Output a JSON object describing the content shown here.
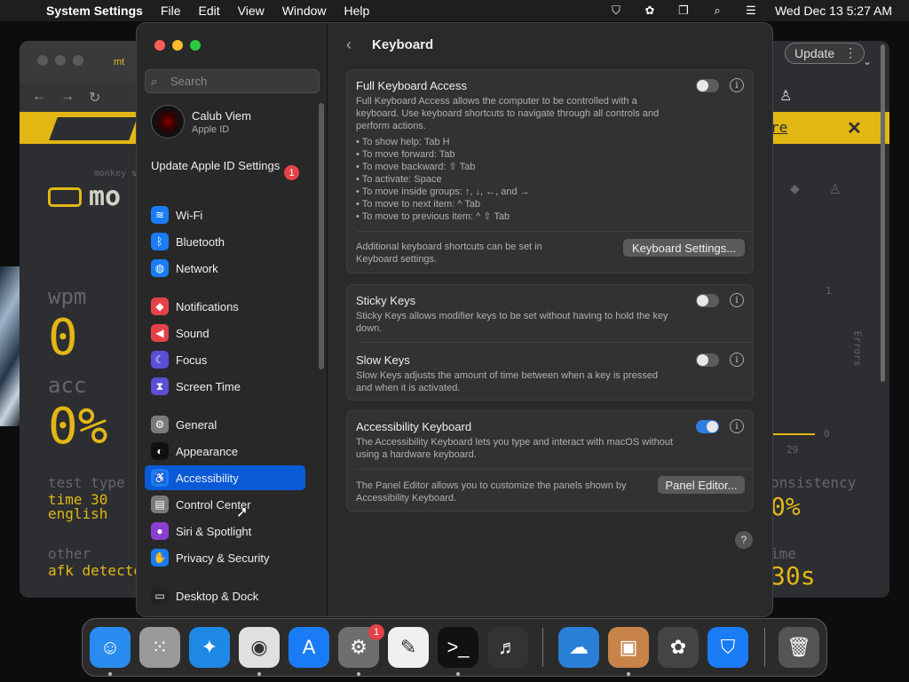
{
  "menubar": {
    "app": "System Settings",
    "items": [
      "File",
      "Edit",
      "View",
      "Window",
      "Help"
    ],
    "clock": "Wed Dec 13  5:27 AM"
  },
  "browser": {
    "tab_title": "mt",
    "update_label": "Update",
    "logo_text": "mo",
    "logo_sub": "monkey s",
    "stats": {
      "wpm_label": "wpm",
      "wpm_value": "0",
      "acc_label": "acc",
      "acc_value": "0%",
      "test_type_label": "test type",
      "test_type_value1": "time 30",
      "test_type_value2": "english",
      "other_label": "other",
      "other_value": "afk detecte",
      "consistency_label": "onsistency",
      "consistency_value": "0%",
      "time_label": "ime",
      "time_value": "30s",
      "errors_label": "Errors",
      "axis_one": "1",
      "axis_zero": "0",
      "axis_29": "29",
      "banner_text": "re"
    }
  },
  "settings": {
    "search_placeholder": "Search",
    "profile": {
      "name": "Calub Viem",
      "sub": "Apple ID"
    },
    "update_id": "Update Apple ID Settings",
    "update_badge": "1",
    "sidebar": [
      {
        "label": "Wi-Fi",
        "icon": "wifi-icon",
        "color": "#1a7cf5",
        "glyph": "≋"
      },
      {
        "label": "Bluetooth",
        "icon": "bluetooth-icon",
        "color": "#1a7cf5",
        "glyph": "ᛒ"
      },
      {
        "label": "Network",
        "icon": "globe-icon",
        "color": "#1a7cf5",
        "glyph": "◍"
      },
      {
        "label": "Notifications",
        "icon": "bell-icon",
        "color": "#e4424a",
        "glyph": "◆"
      },
      {
        "label": "Sound",
        "icon": "speaker-icon",
        "color": "#e4424a",
        "glyph": "◀"
      },
      {
        "label": "Focus",
        "icon": "moon-icon",
        "color": "#5b4fd6",
        "glyph": "☾"
      },
      {
        "label": "Screen Time",
        "icon": "hourglass-icon",
        "color": "#5b4fd6",
        "glyph": "⧗"
      },
      {
        "label": "General",
        "icon": "gear-icon",
        "color": "#7a7a7a",
        "glyph": "⚙"
      },
      {
        "label": "Appearance",
        "icon": "appearance-icon",
        "color": "#111111",
        "glyph": "◐"
      },
      {
        "label": "Accessibility",
        "icon": "accessibility-icon",
        "color": "#1a7cf5",
        "glyph": "♿"
      },
      {
        "label": "Control Center",
        "icon": "control-center-icon",
        "color": "#7a7a7a",
        "glyph": "▤"
      },
      {
        "label": "Siri & Spotlight",
        "icon": "siri-icon",
        "color": "#8a3fd0",
        "glyph": "●"
      },
      {
        "label": "Privacy & Security",
        "icon": "hand-icon",
        "color": "#1a7cf5",
        "glyph": "✋"
      },
      {
        "label": "Desktop & Dock",
        "icon": "dock-icon",
        "color": "#222222",
        "glyph": "▭"
      }
    ],
    "page_title": "Keyboard",
    "fka": {
      "title": "Full Keyboard Access",
      "desc": "Full Keyboard Access allows the computer to be controlled with a keyboard. Use keyboard shortcuts to navigate through all controls and perform actions.",
      "shortcuts": [
        "• To show help: Tab H",
        "• To move forward: Tab",
        "• To move backward: ⇧ Tab",
        "• To activate: Space",
        "• To move inside groups: ↑, ↓, ←, and →",
        "• To move to next item: ^ Tab",
        "• To move to previous item: ^ ⇧ Tab"
      ],
      "additional": "Additional keyboard shortcuts can be set in Keyboard settings.",
      "button": "Keyboard Settings..."
    },
    "sticky": {
      "title": "Sticky Keys",
      "desc": "Sticky Keys allows modifier keys to be set without having to hold the key down."
    },
    "slow": {
      "title": "Slow Keys",
      "desc": "Slow Keys adjusts the amount of time between when a key is pressed and when it is activated."
    },
    "acc_kb": {
      "title": "Accessibility Keyboard",
      "desc": "The Accessibility Keyboard lets you type and interact with macOS without using a hardware keyboard.",
      "panel_desc": "The Panel Editor allows you to customize the panels shown by Accessibility Keyboard.",
      "button": "Panel Editor..."
    },
    "help_glyph": "?"
  },
  "dock": {
    "settings_badge": "1",
    "apps": [
      {
        "name": "finder-icon",
        "color": "#2a8cf0",
        "glyph": "☺"
      },
      {
        "name": "launchpad-icon",
        "color": "#9a9a9a",
        "glyph": "⁙"
      },
      {
        "name": "safari-icon",
        "color": "#1e88e5",
        "glyph": "✦"
      },
      {
        "name": "chrome-icon",
        "color": "#e0e0e0",
        "glyph": "◉"
      },
      {
        "name": "app-store-icon",
        "color": "#1a7cf5",
        "glyph": "A"
      },
      {
        "name": "system-settings-icon",
        "color": "#6e6e6e",
        "glyph": "⚙"
      },
      {
        "name": "textedit-icon",
        "color": "#f0f0f0",
        "glyph": "✎"
      },
      {
        "name": "terminal-icon",
        "color": "#111111",
        "glyph": ">_"
      },
      {
        "name": "garageband-icon",
        "color": "#333333",
        "glyph": "♬"
      },
      {
        "name": "weather-icon",
        "color": "#2a7fd6",
        "glyph": "☁"
      },
      {
        "name": "archive-icon",
        "color": "#c8834a",
        "glyph": "▣"
      },
      {
        "name": "bee-icon",
        "color": "#444444",
        "glyph": "✿"
      },
      {
        "name": "shield-vpn-icon",
        "color": "#1a7cf5",
        "glyph": "⛉"
      },
      {
        "name": "trash-icon",
        "color": "#555555",
        "glyph": "🗑"
      }
    ]
  }
}
